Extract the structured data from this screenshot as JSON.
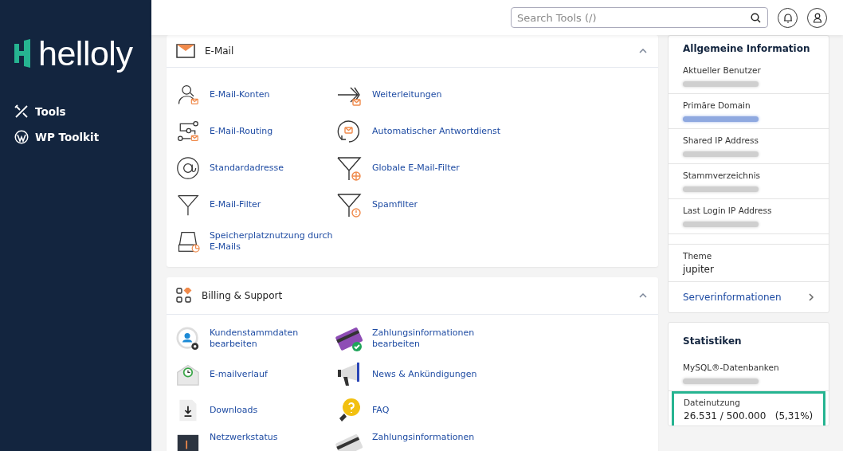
{
  "sidebar": {
    "logo": "helloly",
    "items": [
      {
        "label": "Tools"
      },
      {
        "label": "WP Toolkit"
      }
    ]
  },
  "search": {
    "placeholder": "Search Tools (/)"
  },
  "sections": [
    {
      "title": "E-Mail",
      "expanded": true,
      "items": [
        {
          "label": "E-Mail-Konten"
        },
        {
          "label": "Weiterleitungen"
        },
        {
          "label": "E-Mail-Routing"
        },
        {
          "label": "Automatischer Antwortdienst"
        },
        {
          "label": "Standardadresse"
        },
        {
          "label": "Globale E-Mail-Filter"
        },
        {
          "label": "E-Mail-Filter"
        },
        {
          "label": "Spamfilter"
        },
        {
          "label": "Speicherplatznutzung durch E-Mails"
        }
      ]
    },
    {
      "title": "Billing & Support",
      "expanded": true,
      "items": [
        {
          "label": "Kundenstammdaten bearbeiten"
        },
        {
          "label": "Zahlungsinformationen bearbeiten"
        },
        {
          "label": "E-mailverlauf"
        },
        {
          "label": "News & Ankündigungen"
        },
        {
          "label": "Downloads"
        },
        {
          "label": "FAQ"
        },
        {
          "label": "Netzwerkstatus"
        },
        {
          "label": "Zahlungsinformationen"
        }
      ]
    }
  ],
  "info": {
    "title": "Allgemeine Information",
    "groups": [
      [
        {
          "label": "Aktueller Benutzer",
          "blurred": true
        },
        {
          "label": "Primäre Domain",
          "blurred": true,
          "link": true
        },
        {
          "label": "Shared IP Address",
          "blurred": true
        },
        {
          "label": "Stammverzeichnis",
          "blurred": true
        },
        {
          "label": "Last Login IP Address",
          "blurred": true
        }
      ],
      [
        {
          "label": "Theme",
          "value": "jupiter"
        }
      ]
    ],
    "link": "Serverinformationen"
  },
  "stats": {
    "title": "Statistiken",
    "rows": [
      {
        "label": "MySQL®-Datenbanken",
        "blurred": true,
        "highlighted": false
      },
      {
        "label": "Dateinutzung",
        "value": "26.531 / 500.000   (5,31%)",
        "blurred": false,
        "highlighted": true
      }
    ]
  }
}
